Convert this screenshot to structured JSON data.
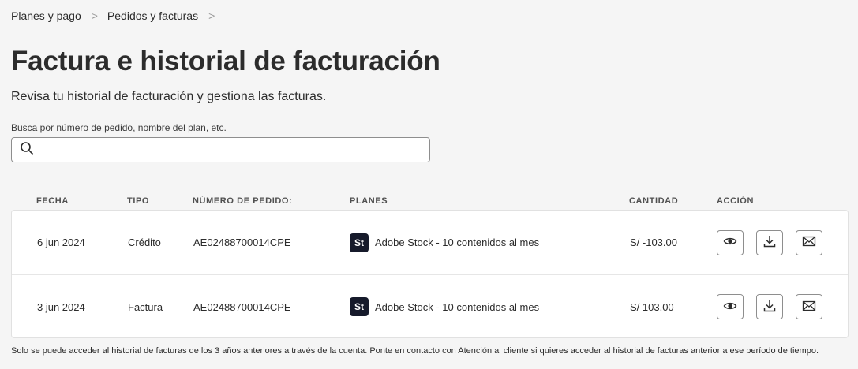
{
  "breadcrumb": {
    "items": [
      {
        "label": "Planes y pago"
      },
      {
        "label": "Pedidos y facturas"
      }
    ],
    "separator": ">"
  },
  "header": {
    "title": "Factura e historial de facturación",
    "subtitle": "Revisa tu historial de facturación y gestiona las facturas."
  },
  "search": {
    "label": "Busca por número de pedido, nombre del plan, etc.",
    "value": "",
    "icon": "search-icon"
  },
  "table": {
    "columns": [
      "FECHA",
      "TIPO",
      "NÚMERO DE PEDIDO:",
      "PLANES",
      "CANTIDAD",
      "ACCIÓN"
    ],
    "rows": [
      {
        "date": "6 jun 2024",
        "type": "Crédito",
        "order": "AE02488700014CPE",
        "plan_icon": "St",
        "plan": "Adobe Stock - 10 contenidos al mes",
        "amount": "S/ -103.00"
      },
      {
        "date": "3 jun 2024",
        "type": "Factura",
        "order": "AE02488700014CPE",
        "plan_icon": "St",
        "plan": "Adobe Stock - 10 contenidos al mes",
        "amount": "S/ 103.00"
      }
    ],
    "actions": [
      "eye-icon",
      "download-icon",
      "envelope-icon"
    ]
  },
  "footnote": "Solo se puede acceder al historial de facturas de los 3 años anteriores a través de la cuenta. Ponte en contacto con Atención al cliente si quieres acceder al historial de facturas anterior a ese período de tiempo.",
  "colors": {
    "background": "#f5f5f5",
    "text": "#2c2c2c",
    "stock_icon_bg": "#161a2b",
    "border": "#8e8e8e"
  }
}
